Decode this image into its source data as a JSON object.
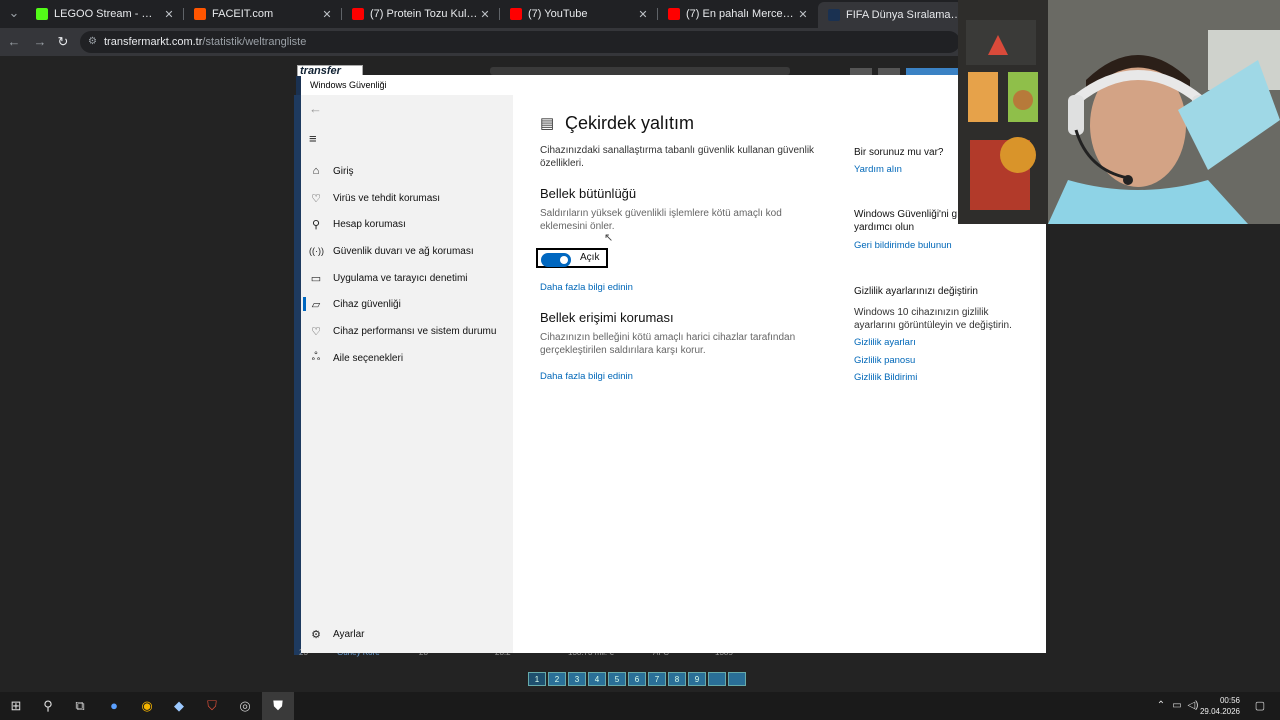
{
  "browser": {
    "tabs": [
      {
        "label": "LEGOO Stream - Watch Live on",
        "fav_color": "#53fc18"
      },
      {
        "label": "FACEIT.com",
        "fav_color": "#ff5500"
      },
      {
        "label": "(7) Protein Tozu Kullanırken Dü",
        "fav_color": "#ff0000"
      },
      {
        "label": "(7) YouTube",
        "fav_color": "#ff0000"
      },
      {
        "label": "(7) En pahalı Mercedes nasıl sıfı",
        "fav_color": "#ff0000"
      },
      {
        "label": "FIFA Dünya Sıralaması | Transfe",
        "fav_color": "#1a3151",
        "active": true
      }
    ],
    "close_glyph": "✕",
    "address_domain": "transfermarkt.com.tr",
    "address_path": "/statistik/weltrangliste"
  },
  "background_page": {
    "logo": "transfer",
    "row": [
      "23",
      "Güney Kore",
      "28",
      "28.2",
      "138.73 mil. €",
      "AFC",
      "1385"
    ],
    "pager": [
      "1",
      "2",
      "3",
      "4",
      "5",
      "6",
      "7",
      "8",
      "9",
      "",
      ""
    ]
  },
  "security_window": {
    "title": "Windows Güvenliği",
    "sidebar": [
      {
        "label": "Giriş",
        "icon": "home-icon"
      },
      {
        "label": "Virüs ve tehdit koruması",
        "icon": "shield-icon"
      },
      {
        "label": "Hesap koruması",
        "icon": "person-icon"
      },
      {
        "label": "Güvenlik duvarı ve ağ koruması",
        "icon": "antenna-icon"
      },
      {
        "label": "Uygulama ve tarayıcı denetimi",
        "icon": "app-browser-icon"
      },
      {
        "label": "Cihaz güvenliği",
        "icon": "laptop-icon",
        "selected": true
      },
      {
        "label": "Cihaz performansı ve sistem durumu",
        "icon": "heart-icon"
      },
      {
        "label": "Aile seçenekleri",
        "icon": "family-icon"
      }
    ],
    "settings_label": "Ayarlar",
    "main": {
      "title": "Çekirdek yalıtım",
      "description": "Cihazınızdaki sanallaştırma tabanlı güvenlik kullanan güvenlik özellikleri.",
      "memory_integrity": {
        "heading": "Bellek bütünlüğü",
        "description": "Saldırıların yüksek güvenlikli işlemlere kötü amaçlı kod eklemesini önler.",
        "toggle_label": "Açık",
        "toggle_on": true,
        "link": "Daha fazla bilgi edinin"
      },
      "memory_access": {
        "heading": "Bellek erişimi koruması",
        "description": "Cihazınızın belleğini kötü amaçlı harici cihazlar tarafından gerçekleştirilen saldırılara karşı korur.",
        "link": "Daha fazla bilgi edinin"
      }
    },
    "right_panel": {
      "help_heading": "Bir sorunuz mu var?",
      "help_link": "Yardım alın",
      "improve_heading": "Windows Güvenliği'ni g yardımcı olun",
      "improve_link": "Geri bildirimde bulunun",
      "privacy_heading": "Gizlilik ayarlarınızı değiştirin",
      "privacy_text": "Windows 10 cihazınızın gizlilik ayarlarını görüntüleyin ve değiştirin.",
      "privacy_links": [
        "Gizlilik ayarları",
        "Gizlilik panosu",
        "Gizlilik Bildirimi"
      ]
    }
  },
  "taskbar": {
    "time": "00:56",
    "date": "29.04.2026"
  }
}
